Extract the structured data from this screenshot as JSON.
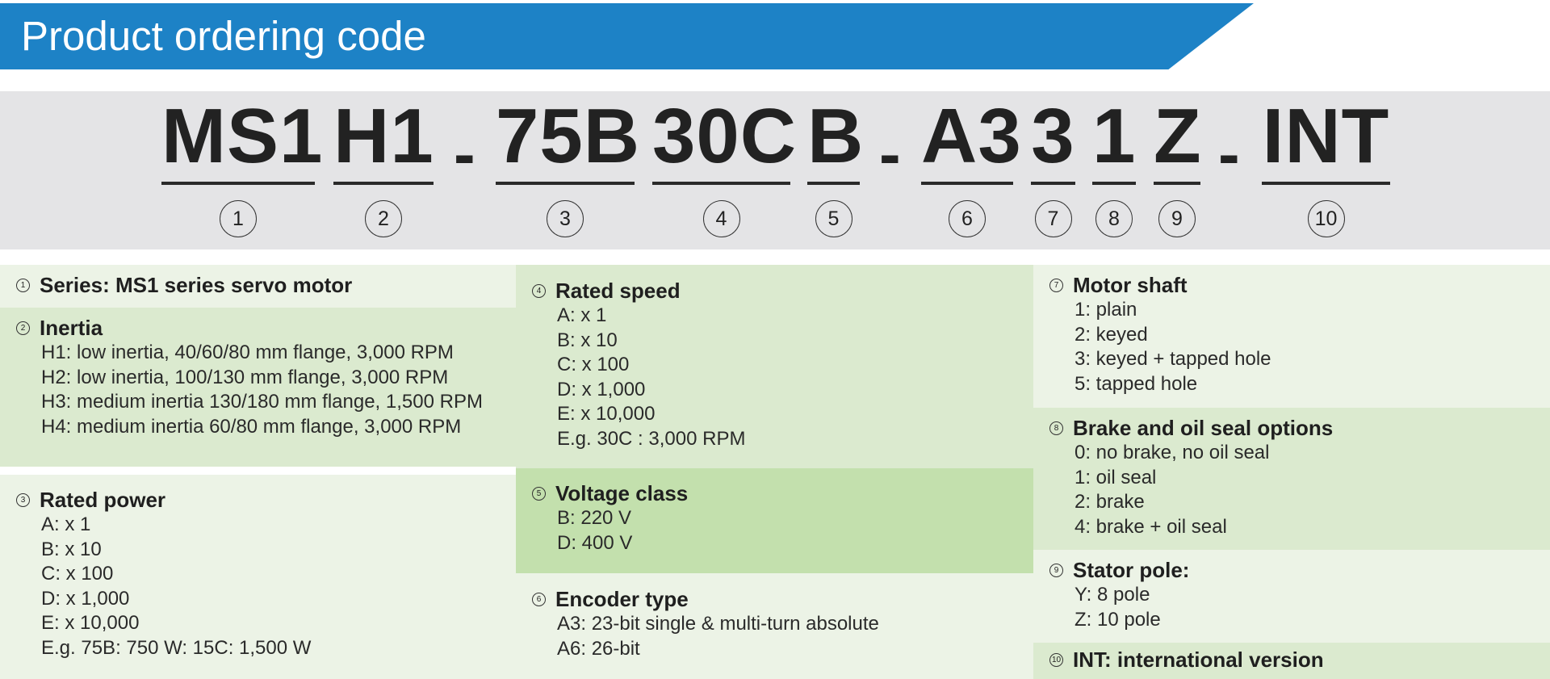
{
  "title": "Product ordering code",
  "code": {
    "segments": [
      {
        "text": "MS1",
        "num": "1"
      },
      {
        "text": "H1",
        "num": "2"
      },
      {
        "text": "75B",
        "num": "3"
      },
      {
        "text": "30C",
        "num": "4"
      },
      {
        "text": "B",
        "num": "5"
      },
      {
        "text": "A3",
        "num": "6"
      },
      {
        "text": "3",
        "num": "7"
      },
      {
        "text": "1",
        "num": "8"
      },
      {
        "text": "Z",
        "num": "9"
      },
      {
        "text": "INT",
        "num": "10"
      }
    ],
    "dash": "-"
  },
  "sections": [
    {
      "num": "1",
      "title": "Series: MS1 series servo motor",
      "lines": []
    },
    {
      "num": "2",
      "title": "Inertia",
      "lines": [
        "H1: low inertia, 40/60/80 mm flange, 3,000 RPM",
        "H2: low inertia, 100/130 mm flange, 3,000 RPM",
        "H3: medium inertia 130/180 mm flange, 1,500 RPM",
        "H4: medium inertia 60/80 mm flange, 3,000 RPM"
      ]
    },
    {
      "num": "3",
      "title": "Rated power",
      "lines": [
        "A: x 1",
        "B: x 10",
        "C: x 100",
        "D: x 1,000",
        "E: x 10,000",
        "E.g. 75B: 750 W: 15C: 1,500 W"
      ]
    },
    {
      "num": "4",
      "title": "Rated speed",
      "lines": [
        "A: x 1",
        "B: x 10",
        "C: x 100",
        "D: x 1,000",
        "E: x 10,000",
        "E.g. 30C : 3,000 RPM"
      ]
    },
    {
      "num": "5",
      "title": "Voltage class",
      "lines": [
        "B: 220 V",
        "D: 400 V"
      ]
    },
    {
      "num": "6",
      "title": "Encoder type",
      "lines": [
        "A3: 23-bit single & multi-turn absolute",
        "A6: 26-bit"
      ]
    },
    {
      "num": "7",
      "title": "Motor shaft",
      "lines": [
        "1: plain",
        "2: keyed",
        "3: keyed + tapped hole",
        "5: tapped hole"
      ]
    },
    {
      "num": "8",
      "title": "Brake and oil seal options",
      "lines": [
        "0: no brake, no oil seal",
        "1: oil seal",
        "2: brake",
        "4: brake + oil seal"
      ]
    },
    {
      "num": "9",
      "title": "Stator pole:",
      "lines": [
        "Y: 8 pole",
        "Z: 10 pole"
      ]
    },
    {
      "num": "10",
      "title": "INT: international version",
      "lines": []
    }
  ]
}
